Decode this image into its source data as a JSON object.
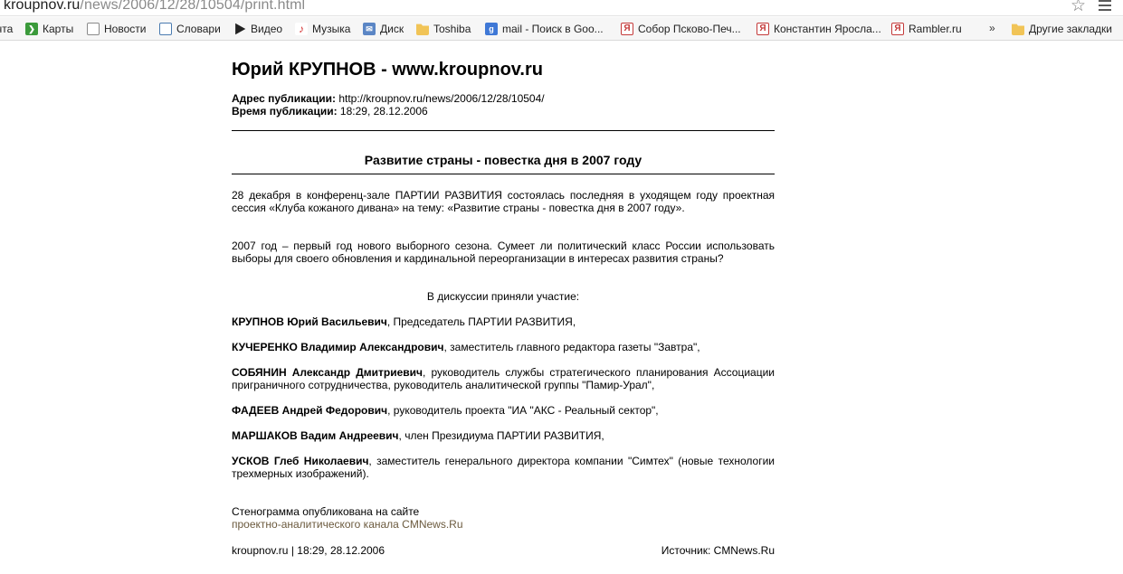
{
  "browser": {
    "url_host": "kroupnov.ru",
    "url_path": "/news/2006/12/28/10504/print.html",
    "bookmarks": [
      {
        "label": "чта",
        "icon": "none"
      },
      {
        "label": "Карты",
        "icon": "maps-icon"
      },
      {
        "label": "Новости",
        "icon": "page-icon"
      },
      {
        "label": "Словари",
        "icon": "dictionary-icon"
      },
      {
        "label": "Видео",
        "icon": "video-icon"
      },
      {
        "label": "Музыка",
        "icon": "music-icon"
      },
      {
        "label": "Диск",
        "icon": "mail-icon"
      },
      {
        "label": "Toshiba",
        "icon": "folder-icon"
      },
      {
        "label": "mail - Поиск в Goo...",
        "icon": "google-icon"
      },
      {
        "label": "Собор Псково-Печ...",
        "icon": "yandex-icon"
      },
      {
        "label": "Константин Яросла...",
        "icon": "yandex-icon"
      },
      {
        "label": "Rambler.ru",
        "icon": "yandex-icon"
      },
      {
        "label": "Другие закладки",
        "icon": "folder-icon"
      }
    ],
    "more_label": "»"
  },
  "article": {
    "site_title": "Юрий КРУПНОВ - www.kroupnov.ru",
    "address_label": "Адрес публикации:",
    "address_value": "http://kroupnov.ru/news/2006/12/28/10504/",
    "time_label": "Время публикации:",
    "time_value": "18:29, 28.12.2006",
    "headline": "Развитие страны - повестка дня в 2007 году",
    "paragraphs": [
      "28 декабря в конференц-зале ПАРТИИ РАЗВИТИЯ состоялась последняя в уходящем году проектная сессия «Клуба кожаного дивана» на тему: «Развитие страны - повестка дня в 2007 году».",
      "2007 год – первый год нового выборного сезона. Сумеет ли политический класс России использовать выборы для своего обновления и кардинальной переорганизации в интересах развития страны?"
    ],
    "participants_intro": "В дискуссии приняли участие:",
    "participants": [
      {
        "name": "КРУПНОВ Юрий Васильевич",
        "role": ", Председатель ПАРТИИ РАЗВИТИЯ,"
      },
      {
        "name": "КУЧЕРЕНКО Владимир Александрович",
        "role": ", заместитель главного редактора газеты \"Завтра\","
      },
      {
        "name": "СОБЯНИН Александр Дмитриевич",
        "role": ", руководитель службы стратегического планирования Ассоциации приграничного сотрудничества, руководитель аналитической группы \"Памир-Урал\","
      },
      {
        "name": "ФАДЕЕВ Андрей Федорович",
        "role": ", руководитель проекта \"ИА \"АКС - Реальный сектор\","
      },
      {
        "name": "МАРШАКОВ Вадим Андреевич",
        "role": ", член Президиума ПАРТИИ РАЗВИТИЯ,"
      },
      {
        "name": "УСКОВ Глеб Николаевич",
        "role": ", заместитель генерального директора компании \"Симтех\" (новые технологии трехмерных изображений)."
      }
    ],
    "steno_text": "Стенограмма опубликована на сайте",
    "steno_link": "проектно-аналитического канала CMNews.Ru",
    "footer_left": "kroupnov.ru | 18:29, 28.12.2006",
    "footer_right": "Источник: CMNews.Ru"
  }
}
